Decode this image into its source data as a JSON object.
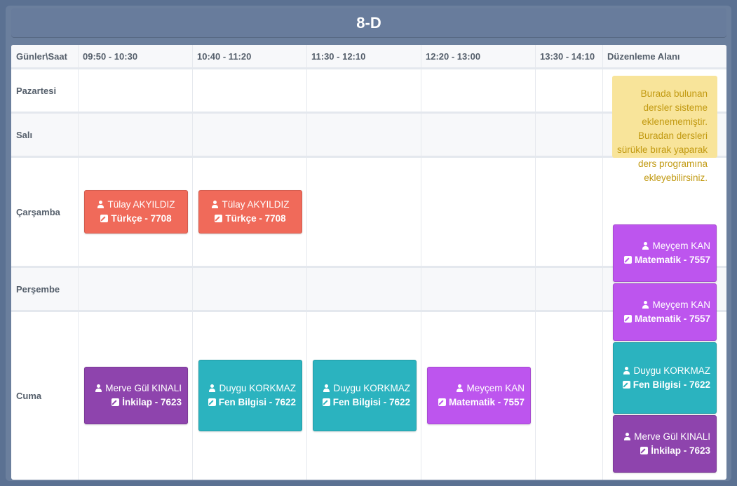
{
  "title": "8-D",
  "headers": [
    "Günler\\Saat",
    "09:50 - 10:30",
    "10:40 - 11:20",
    "11:30 - 12:10",
    "12:20 - 13:00",
    "13:30 - 14:10",
    "Düzenleme Alanı"
  ],
  "days": [
    "Pazartesi",
    "Salı",
    "Çarşamba",
    "Perşembe",
    "Cuma"
  ],
  "note": "Burada bulunan dersler sisteme eklenememiştir. Buradan dersleri sürükle bırak yaparak ders programına ekleyebilirsiniz.",
  "schedule": {
    "carsamba_1": {
      "teacher": "Tülay AKYILDIZ",
      "lesson": "Türkçe - 7708"
    },
    "carsamba_2": {
      "teacher": "Tülay AKYILDIZ",
      "lesson": "Türkçe - 7708"
    },
    "cuma_1": {
      "teacher": "Merve Gül KINALI",
      "lesson": "İnkilap - 7623"
    },
    "cuma_2": {
      "teacher": "Duygu KORKMAZ",
      "lesson": "Fen Bilgisi - 7622"
    },
    "cuma_3": {
      "teacher": "Duygu KORKMAZ",
      "lesson": "Fen Bilgisi - 7622"
    },
    "cuma_4": {
      "teacher": "Meyçem KAN",
      "lesson": "Matematik - 7557"
    }
  },
  "editing_area": [
    {
      "teacher": "Meyçem KAN",
      "lesson": "Matematik - 7557"
    },
    {
      "teacher": "Meyçem KAN",
      "lesson": "Matematik - 7557"
    },
    {
      "teacher": "Duygu KORKMAZ",
      "lesson": "Fen Bilgisi - 7622"
    },
    {
      "teacher": "Merve Gül KINALI",
      "lesson": "İnkilap - 7623"
    }
  ],
  "colors": {
    "turkce": "#f06a5a",
    "inkilap": "#8e44ad",
    "fen": "#2bb3bf",
    "matematik": "#bd55ee",
    "note_bg": "#f8e49a",
    "note_text": "#c29a12"
  },
  "icons": {
    "teacher": "user-icon",
    "lesson": "edit-icon"
  }
}
